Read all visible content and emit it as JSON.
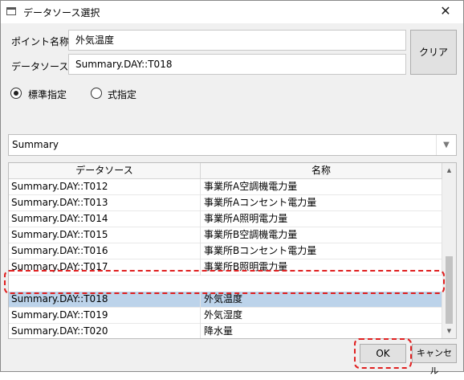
{
  "window": {
    "title": "データソース選択"
  },
  "form": {
    "point_name_label": "ポイント名称:",
    "point_name_value": "外気温度",
    "data_source_label": "データソース:",
    "data_source_value": "Summary.DAY::T018",
    "clear_label": "クリア"
  },
  "mode": {
    "standard_label": "標準指定",
    "formula_label": "式指定",
    "selected": "standard"
  },
  "combo": {
    "value": "Summary"
  },
  "grid": {
    "columns": [
      "データソース",
      "名称"
    ],
    "rows": [
      {
        "source": "Summary.DAY::T012",
        "name": "事業所A空調機電力量"
      },
      {
        "source": "Summary.DAY::T013",
        "name": "事業所Aコンセント電力量"
      },
      {
        "source": "Summary.DAY::T014",
        "name": "事業所A照明電力量"
      },
      {
        "source": "Summary.DAY::T015",
        "name": "事業所B空調機電力量"
      },
      {
        "source": "Summary.DAY::T016",
        "name": "事業所Bコンセント電力量"
      },
      {
        "source": "Summary.DAY::T017",
        "name": "事業所B照明電力量"
      },
      {
        "source": "Summary.DAY::T018",
        "name": "外気温度"
      },
      {
        "source": "Summary.DAY::T019",
        "name": "外気湿度"
      },
      {
        "source": "Summary.DAY::T020",
        "name": "降水量"
      }
    ],
    "selected_index": 6
  },
  "buttons": {
    "ok_label": "OK",
    "cancel_label": "キャンセル"
  },
  "colors": {
    "highlight": "#e02020",
    "selection": "#bcd3ea"
  }
}
